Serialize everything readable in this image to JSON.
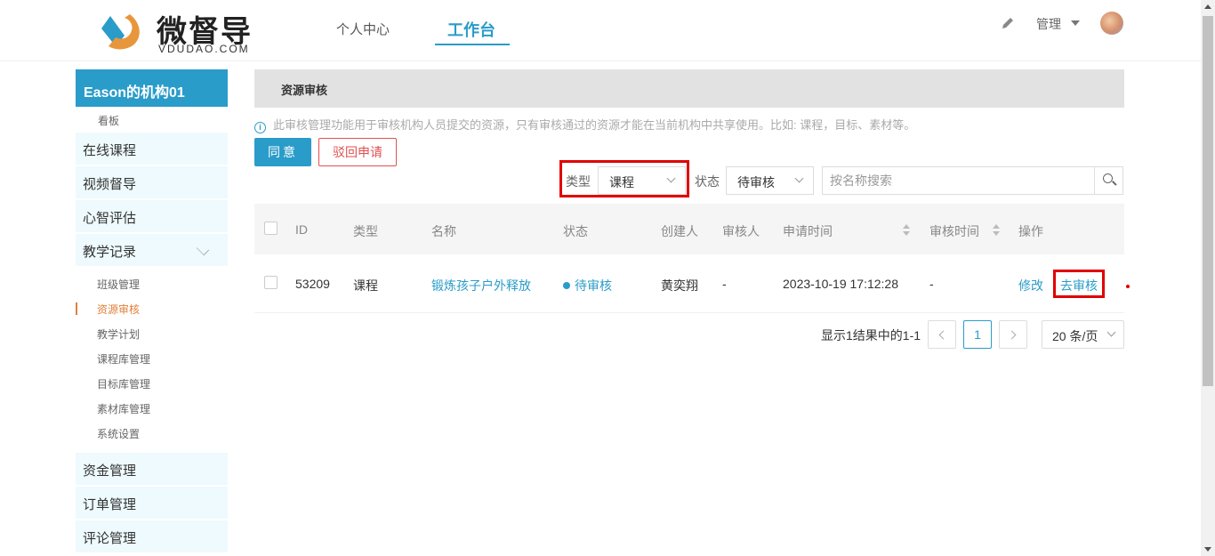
{
  "brand": {
    "name": "微督导",
    "sub": "VDUDAO.COM"
  },
  "nav": {
    "personal": "个人中心",
    "workbench": "工作台"
  },
  "header_right": {
    "manage": "管理"
  },
  "sidebar": {
    "org": "Eason的机构01",
    "dashboard": "看板",
    "online_courses": "在线课程",
    "video_supervision": "视频督导",
    "mental_assessment": "心智评估",
    "teaching_records": "教学记录",
    "sub_items": [
      "班级管理",
      "资源审核",
      "教学计划",
      "课程库管理",
      "目标库管理",
      "素材库管理",
      "系统设置"
    ],
    "funds": "资金管理",
    "orders": "订单管理",
    "comments": "评论管理"
  },
  "page": {
    "title": "资源审核",
    "tip": "此审核管理功能用于审核机构人员提交的资源，只有审核通过的资源才能在当前机构中共享使用。比如: 课程，目标、素材等。",
    "agree": "同意",
    "reject": "驳回申请"
  },
  "filters": {
    "type_label": "类型",
    "type_value": "课程",
    "status_label": "状态",
    "status_value": "待审核",
    "search_placeholder": "按名称搜索"
  },
  "table": {
    "headers": {
      "id": "ID",
      "type": "类型",
      "name": "名称",
      "status": "状态",
      "creator": "创建人",
      "reviewer": "审核人",
      "apply_time": "申请时间",
      "review_time": "审核时间",
      "action": "操作"
    },
    "row": {
      "id": "53209",
      "type": "课程",
      "name": "锻炼孩子户外释放",
      "status": "待审核",
      "creator": "黄奕翔",
      "reviewer": "-",
      "apply_time": "2023-10-19 17:12:28",
      "review_time": "-",
      "edit": "修改",
      "review": "去审核"
    }
  },
  "pagination": {
    "summary": "显示1结果中的1-1",
    "current_page": "1",
    "page_size": "20 条/页"
  },
  "colors": {
    "accent": "#2a9cc9",
    "danger": "#e05050",
    "highlight": "#e00000"
  }
}
